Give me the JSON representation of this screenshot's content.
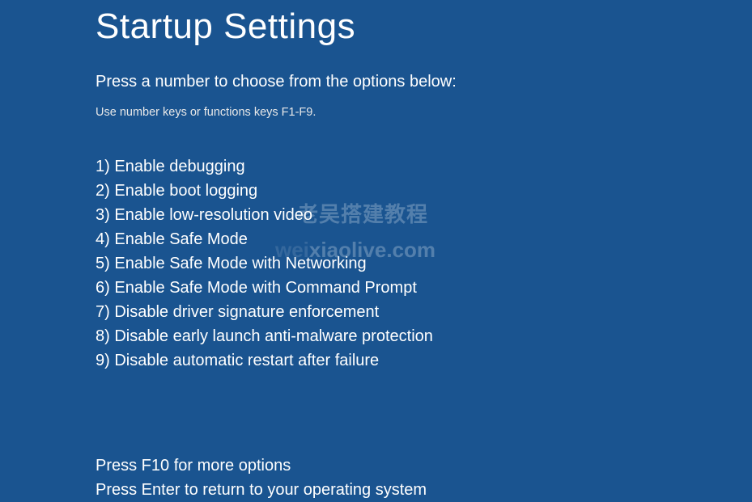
{
  "title": "Startup Settings",
  "subtitle": "Press a number to choose from the options below:",
  "hint": "Use number keys or functions keys F1-F9.",
  "options": [
    {
      "num": "1)",
      "label": "Enable debugging"
    },
    {
      "num": "2)",
      "label": "Enable boot logging"
    },
    {
      "num": "3)",
      "label": "Enable low-resolution video"
    },
    {
      "num": "4)",
      "label": "Enable Safe Mode"
    },
    {
      "num": "5)",
      "label": "Enable Safe Mode with Networking"
    },
    {
      "num": "6)",
      "label": "Enable Safe Mode with Command Prompt"
    },
    {
      "num": "7)",
      "label": "Disable driver signature enforcement"
    },
    {
      "num": "8)",
      "label": "Disable early launch anti-malware protection"
    },
    {
      "num": "9)",
      "label": "Disable automatic restart after failure"
    }
  ],
  "footer": {
    "more": "Press F10 for more options",
    "return": "Press Enter to return to your operating system"
  },
  "watermark": {
    "line1": "老吴搭建教程",
    "line2_dim": "wei",
    "line2_rest": "xiaolive.com"
  }
}
